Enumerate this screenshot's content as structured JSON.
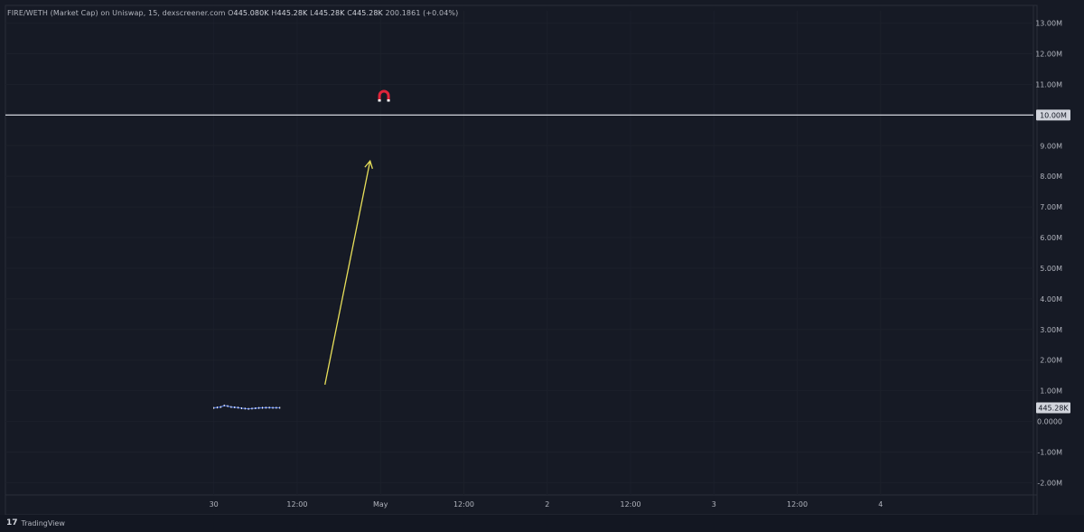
{
  "legend": {
    "symbol": "FIRE/WETH (Market Cap) on Uniswap, 15, dexscreener.com",
    "o_key": "O",
    "o_val": "445.080K",
    "h_key": "H",
    "h_val": "445.28K",
    "l_key": "L",
    "l_val": "445.28K",
    "c_key": "C",
    "c_val": "445.28K",
    "change": "200.1861 (+0.04%)"
  },
  "branding": {
    "label": "TradingView",
    "mark": "17"
  },
  "colors": {
    "background": "#161a25",
    "text": "#d1d4dc",
    "horizontal_line": "#d1d4dc",
    "arrow": "#e8e05a",
    "series": "#4a6fd6",
    "magnet": "#e0243a"
  },
  "icons": {
    "drawing": "magnet-icon"
  },
  "chart_data": {
    "type": "line",
    "title": "",
    "y_axis": {
      "ticks": [
        "13.00M",
        "12.00M",
        "11.00M",
        "9.00M",
        "8.00M",
        "7.00M",
        "6.00M",
        "5.00M",
        "4.00M",
        "3.00M",
        "2.00M",
        "1.00M",
        "0.0000",
        "-1.00M",
        "-2.00M"
      ],
      "tick_values": [
        13000000,
        12000000,
        11000000,
        9000000,
        8000000,
        7000000,
        6000000,
        5000000,
        4000000,
        3000000,
        2000000,
        1000000,
        0,
        -1000000,
        -2000000
      ],
      "ylim": [
        -2400000,
        13400000
      ]
    },
    "x_axis": {
      "ticks": [
        "30",
        "12:00",
        "May",
        "12:00",
        "2",
        "12:00",
        "3",
        "12:00",
        "4"
      ],
      "tick_hours": [
        0,
        12,
        24,
        36,
        48,
        60,
        72,
        84,
        96
      ],
      "xlim_hours": [
        -30,
        118
      ]
    },
    "series": [
      {
        "x_hours": [
          0,
          0.5,
          1,
          1.5,
          2,
          2.5,
          3,
          3.5,
          4,
          4.5,
          5,
          5.5,
          6,
          6.5,
          7,
          7.5,
          8,
          8.5,
          9,
          9.5
        ],
        "values": [
          440000,
          455000,
          470000,
          520000,
          500000,
          470000,
          460000,
          450000,
          430000,
          420000,
          410000,
          420000,
          430000,
          440000,
          445000,
          448000,
          450000,
          445000,
          446000,
          445280
        ]
      }
    ],
    "horizontal_line": {
      "value": 10000000,
      "label": "10.00M"
    },
    "last_price": {
      "value": 445280,
      "label": "445.28K"
    },
    "arrow": {
      "from": {
        "x_hours": 16,
        "value": 1200000
      },
      "to": {
        "x_hours": 22.5,
        "value": 8500000
      }
    },
    "magnet_marker": {
      "x_hours": 24.5,
      "value": 10600000
    },
    "grid": true
  }
}
